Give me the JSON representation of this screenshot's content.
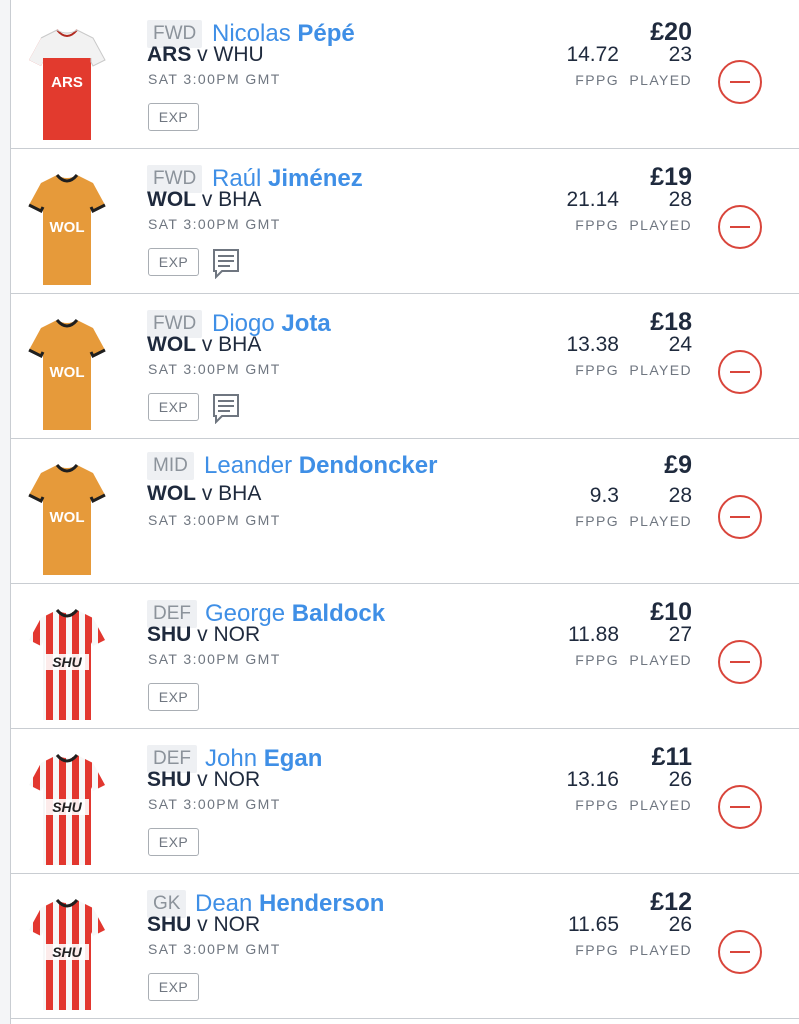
{
  "labels": {
    "fppg": "FPPG",
    "played": "PLAYED",
    "exp": "EXP"
  },
  "players": [
    {
      "position": "FWD",
      "first": "Nicolas",
      "last": "Pépé",
      "home": "ARS",
      "away": "WHU",
      "time": "SAT 3:00PM GMT",
      "fppg": "14.72",
      "played": "23",
      "price": "£20",
      "kit": "ARS",
      "notes": false
    },
    {
      "position": "FWD",
      "first": "Raúl",
      "last": "Jiménez",
      "home": "WOL",
      "away": "BHA",
      "time": "SAT 3:00PM GMT",
      "fppg": "21.14",
      "played": "28",
      "price": "£19",
      "kit": "WOL",
      "notes": true
    },
    {
      "position": "FWD",
      "first": "Diogo",
      "last": "Jota",
      "home": "WOL",
      "away": "BHA",
      "time": "SAT 3:00PM GMT",
      "fppg": "13.38",
      "played": "24",
      "price": "£18",
      "kit": "WOL",
      "notes": true
    },
    {
      "position": "MID",
      "first": "Leander",
      "last": "Dendoncker",
      "home": "WOL",
      "away": "BHA",
      "time": "SAT 3:00PM GMT",
      "fppg": "9.3",
      "played": "28",
      "price": "£9",
      "kit": "WOL",
      "notes": false
    },
    {
      "position": "DEF",
      "first": "George",
      "last": "Baldock",
      "home": "SHU",
      "away": "NOR",
      "time": "SAT 3:00PM GMT",
      "fppg": "11.88",
      "played": "27",
      "price": "£10",
      "kit": "SHU",
      "notes": false
    },
    {
      "position": "DEF",
      "first": "John",
      "last": "Egan",
      "home": "SHU",
      "away": "NOR",
      "time": "SAT 3:00PM GMT",
      "fppg": "13.16",
      "played": "26",
      "price": "£11",
      "kit": "SHU",
      "notes": false
    },
    {
      "position": "GK",
      "first": "Dean",
      "last": "Henderson",
      "home": "SHU",
      "away": "NOR",
      "time": "SAT 3:00PM GMT",
      "fppg": "11.65",
      "played": "26",
      "price": "£12",
      "kit": "SHU",
      "notes": false
    }
  ],
  "colors": {
    "name": "#3f8fe6",
    "remove": "#d9453b",
    "ars": "#e23a2e",
    "wol": "#e69a3a",
    "shu": "#e2372f"
  },
  "icons": {
    "remove": "minus-circle-icon",
    "notes": "notes-icon",
    "shirt": "team-shirt-icon"
  }
}
